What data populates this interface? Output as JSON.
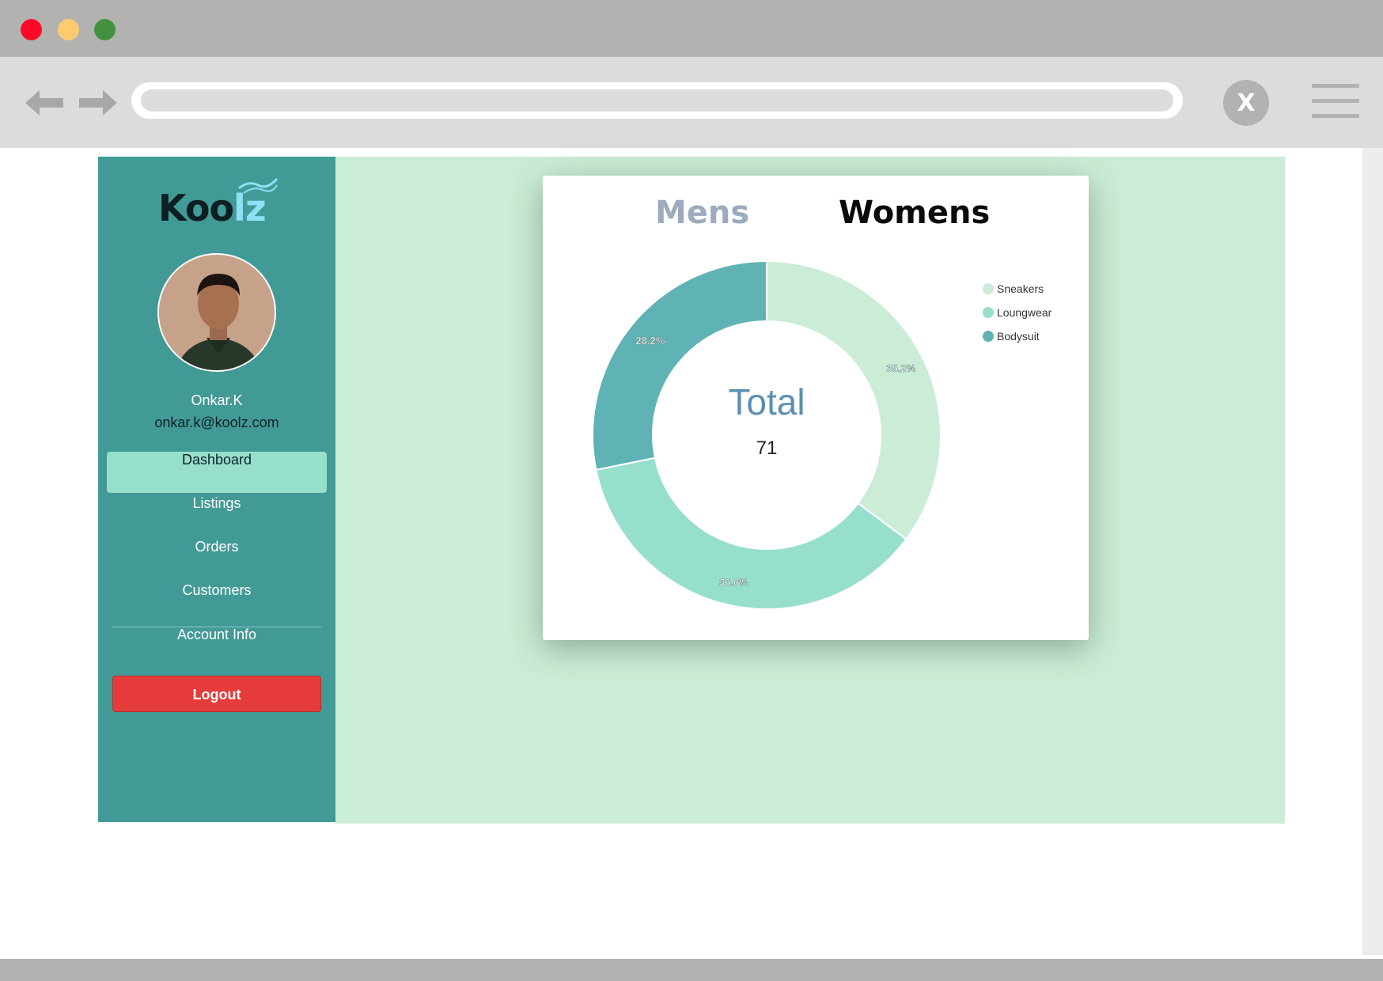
{
  "browser": {
    "colors": {
      "close_dot": "#ff0a26",
      "minimize_dot": "#ffcb70",
      "maximize_dot": "#43913f"
    },
    "close_button_label": "X",
    "icons": [
      "back-arrow-icon",
      "forward-arrow-icon",
      "close-icon",
      "hamburger-menu-icon"
    ]
  },
  "sidebar": {
    "logo": {
      "part1": "Koo",
      "part2": "lz"
    },
    "user": {
      "name": "Onkar.K",
      "email": "onkar.k@koolz.com"
    },
    "items": [
      {
        "label": "Dashboard",
        "active": true
      },
      {
        "label": "Listings",
        "active": false
      },
      {
        "label": "Orders",
        "active": false
      },
      {
        "label": "Customers",
        "active": false
      },
      {
        "label": "Account Info",
        "active": false
      }
    ],
    "logout_label": "Logout",
    "colors": {
      "background": "#429a96",
      "active": "#97dfcd",
      "logout": "#e53c3b"
    }
  },
  "card": {
    "tabs": [
      {
        "label": "Mens",
        "active": false
      },
      {
        "label": "Womens",
        "active": true
      }
    ],
    "center_label": "Total",
    "center_value": "71"
  },
  "chart_data": {
    "type": "pie",
    "donut": true,
    "categories": [
      "Sneakers",
      "Loungwear",
      "Bodysuit"
    ],
    "values": [
      35.2,
      36.6,
      28.2
    ],
    "labels": [
      "35.2%",
      "36.6%",
      "28.2%"
    ],
    "colors": [
      "#cbecd6",
      "#97dfcd",
      "#60b3b4"
    ],
    "legend_position": "top-right"
  }
}
